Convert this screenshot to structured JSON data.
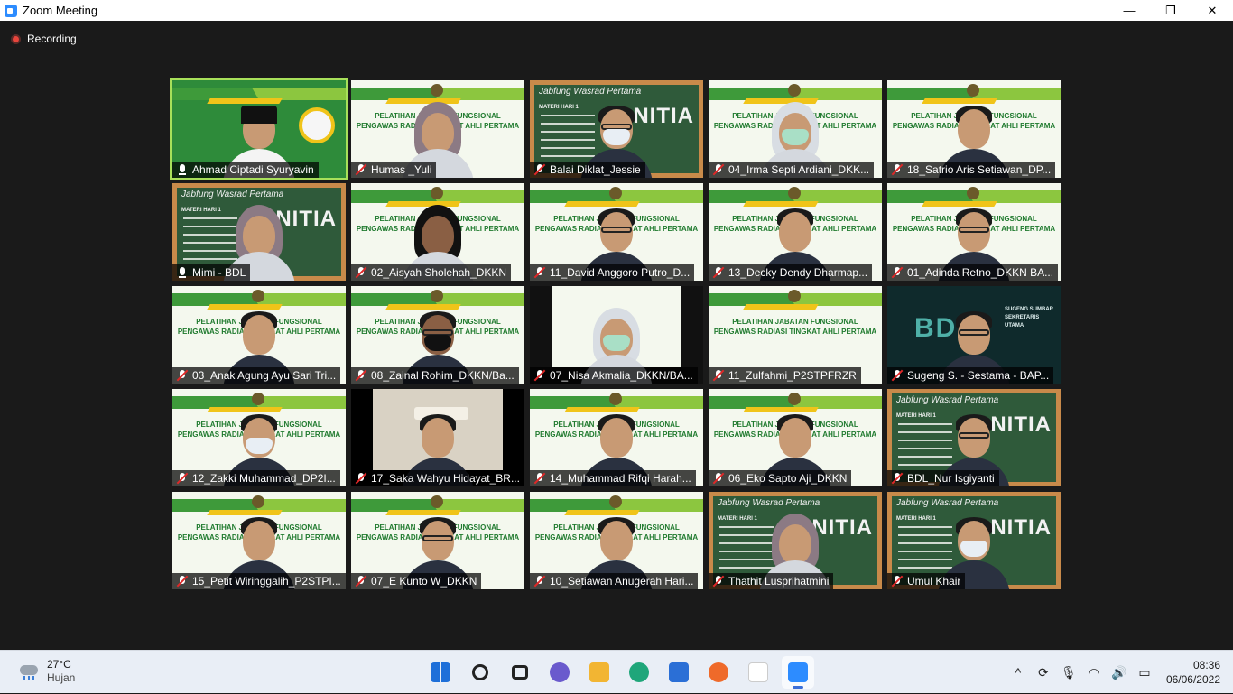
{
  "window": {
    "title": "Zoom Meeting",
    "minimize": "—",
    "maximize": "❐",
    "close": "✕"
  },
  "recording": {
    "label": "Recording"
  },
  "tiles": [
    {
      "name": "Ahmad Ciptadi Syuryavin",
      "bg": "logo",
      "muted": false,
      "active": true,
      "person": "cap"
    },
    {
      "name": "Humas _Yuli",
      "bg": "banner",
      "muted": true,
      "person": "hijab",
      "banner": "PELATIHAN JABATAN FUNGSIONAL\nPENGAWAS RADIASI TINGKAT AHLI PERTAMA"
    },
    {
      "name": "Balai Diklat_Jessie",
      "bg": "board",
      "muted": true,
      "person": "maskglasses"
    },
    {
      "name": "04_Irma Septi Ardiani_DKK...",
      "bg": "banner",
      "muted": true,
      "person": "hijabmask",
      "banner": "PELATIHAN JABATAN FUNGSIONAL\nPENGAWAS RADIASI TINGKAT AHLI PERTAMA"
    },
    {
      "name": "18_Satrio Aris Setiawan_DP...",
      "bg": "banner",
      "muted": true,
      "person": "plain",
      "banner": "PELATIHAN JABATAN FUNGSIONAL\nPENGAWAS RADIASI TINGKAT AHLI PERTAMA"
    },
    {
      "name": "Mimi - BDL",
      "bg": "board",
      "muted": false,
      "person": "hijab"
    },
    {
      "name": "02_Aisyah Sholehah_DKKN",
      "bg": "banner",
      "muted": true,
      "person": "hijabdark",
      "banner": "PELATIHAN JABATAN FUNGSIONAL\nPENGAWAS RADIASI TINGKAT AHLI PERTAMA"
    },
    {
      "name": "11_David Anggoro Putro_D...",
      "bg": "banner",
      "muted": true,
      "person": "glasses",
      "banner": "PELATIHAN JABATAN FUNGSIONAL\nPENGAWAS RADIASI TINGKAT AHLI PERTAMA"
    },
    {
      "name": "13_Decky Dendy Dharmap...",
      "bg": "banner",
      "muted": true,
      "person": "plain",
      "banner": "PELATIHAN JABATAN FUNGSIONAL\nPENGAWAS RADIASI TINGKAT AHLI PERTAMA"
    },
    {
      "name": "01_Adinda Retno_DKKN BA...",
      "bg": "banner",
      "muted": true,
      "person": "glasses",
      "banner": "PELATIHAN JABATAN FUNGSIONAL\nPENGAWAS RADIASI TINGKAT AHLI PERTAMA"
    },
    {
      "name": "03_Anak Agung Ayu Sari Tri...",
      "bg": "banner",
      "muted": true,
      "person": "plain",
      "banner": "PELATIHAN JABATAN FUNGSIONAL\nPENGAWAS RADIASI TINGKAT AHLI PERTAMA"
    },
    {
      "name": "08_Zainal Rohim_DKKN/Ba...",
      "bg": "banner",
      "muted": true,
      "person": "maskglassesdark",
      "banner": "PELATIHAN JABATAN FUNGSIONAL\nPENGAWAS RADIASI TINGKAT AHLI PERTAMA"
    },
    {
      "name": "07_Nisa Akmalia_DKKN/BA...",
      "bg": "whitepanel",
      "muted": true,
      "person": "hijabmask"
    },
    {
      "name": "11_Zulfahmi_P2STPFRZR",
      "bg": "banner",
      "muted": true,
      "person": "none",
      "banner": "PELATIHAN JABATAN FUNGSIONAL\nPENGAWAS RADIASI TINGKAT AHLI PERTAMA"
    },
    {
      "name": "Sugeng S. - Sestama - BAP...",
      "bg": "dark",
      "muted": true,
      "person": "glasses"
    },
    {
      "name": "12_Zakki Muhammad_DP2I...",
      "bg": "banner",
      "muted": true,
      "person": "mask",
      "banner": "PELATIHAN JABATAN FUNGSIONAL\nPENGAWAS RADIASI TINGKAT AHLI PERTAMA"
    },
    {
      "name": "17_Saka Wahyu Hidayat_BR...",
      "bg": "room",
      "muted": true,
      "person": "plain"
    },
    {
      "name": "14_Muhammad Rifqi Harah...",
      "bg": "banner",
      "muted": true,
      "person": "plain",
      "banner": "PELATIHAN JABATAN FUNGSIONAL\nPENGAWAS RADIASI TINGKAT AHLI PERTAMA"
    },
    {
      "name": "06_Eko Sapto Aji_DKKN",
      "bg": "banner",
      "muted": true,
      "person": "plain",
      "banner": "PELATIHAN JABATAN FUNGSIONAL\nPENGAWAS RADIASI TINGKAT AHLI PERTAMA"
    },
    {
      "name": "BDL_Nur Isgiyanti",
      "bg": "board",
      "muted": true,
      "person": "glasses"
    },
    {
      "name": "15_Petit Wiringgalih_P2STPI...",
      "bg": "banner",
      "muted": true,
      "person": "plain",
      "banner": "PELATIHAN JABATAN FUNGSIONAL\nPENGAWAS RADIASI TINGKAT AHLI PERTAMA"
    },
    {
      "name": "07_E Kunto W_DKKN",
      "bg": "banner",
      "muted": true,
      "person": "glasses",
      "banner": "PELATIHAN JABATAN FUNGSIONAL\nPENGAWAS RADIASI TINGKAT AHLI PERTAMA"
    },
    {
      "name": "10_Setiawan Anugerah Hari...",
      "bg": "banner",
      "muted": true,
      "person": "plain",
      "banner": "PELATIHAN JABATAN FUNGSIONAL\nPENGAWAS RADIASI TINGKAT AHLI PERTAMA"
    },
    {
      "name": "Thathit Lusprihatmini",
      "bg": "board",
      "muted": true,
      "person": "hijab"
    },
    {
      "name": "Umul Khair",
      "bg": "board",
      "muted": true,
      "person": "mask"
    }
  ],
  "board": {
    "title": "Jabfung Wasrad Pertama",
    "big": "PANITIA",
    "sub": "MATERI HARI 1"
  },
  "dark_bg": {
    "logo": "BDL",
    "text": "SUGENG SUMBAR\nSEKRETARIS\nUTAMA"
  },
  "taskbar": {
    "weather_temp": "27°C",
    "weather_cond": "Hujan",
    "time": "08:36",
    "date": "06/06/2022",
    "apps": [
      {
        "name": "windows-start-icon",
        "color": "#1e6fd9"
      },
      {
        "name": "search-icon",
        "color": "#222222"
      },
      {
        "name": "task-view-icon",
        "color": "#222222"
      },
      {
        "name": "teams-chat-icon",
        "color": "#6a5acd"
      },
      {
        "name": "file-explorer-icon",
        "color": "#f2b533"
      },
      {
        "name": "edge-icon",
        "color": "#1fa67a"
      },
      {
        "name": "store-icon",
        "color": "#2b6fd6"
      },
      {
        "name": "firefox-icon",
        "color": "#ef6a2a"
      },
      {
        "name": "amazon-icon",
        "color": "#ffffff"
      },
      {
        "name": "zoom-icon",
        "color": "#2d8cff"
      }
    ],
    "tray": [
      {
        "name": "chevron-up-icon",
        "glyph": "^"
      },
      {
        "name": "network-status-icon",
        "glyph": "⟳"
      },
      {
        "name": "microphone-icon",
        "glyph": "🎙"
      },
      {
        "name": "wifi-icon",
        "glyph": "◠"
      },
      {
        "name": "volume-icon",
        "glyph": "🔊"
      },
      {
        "name": "battery-icon",
        "glyph": "▭"
      }
    ]
  }
}
